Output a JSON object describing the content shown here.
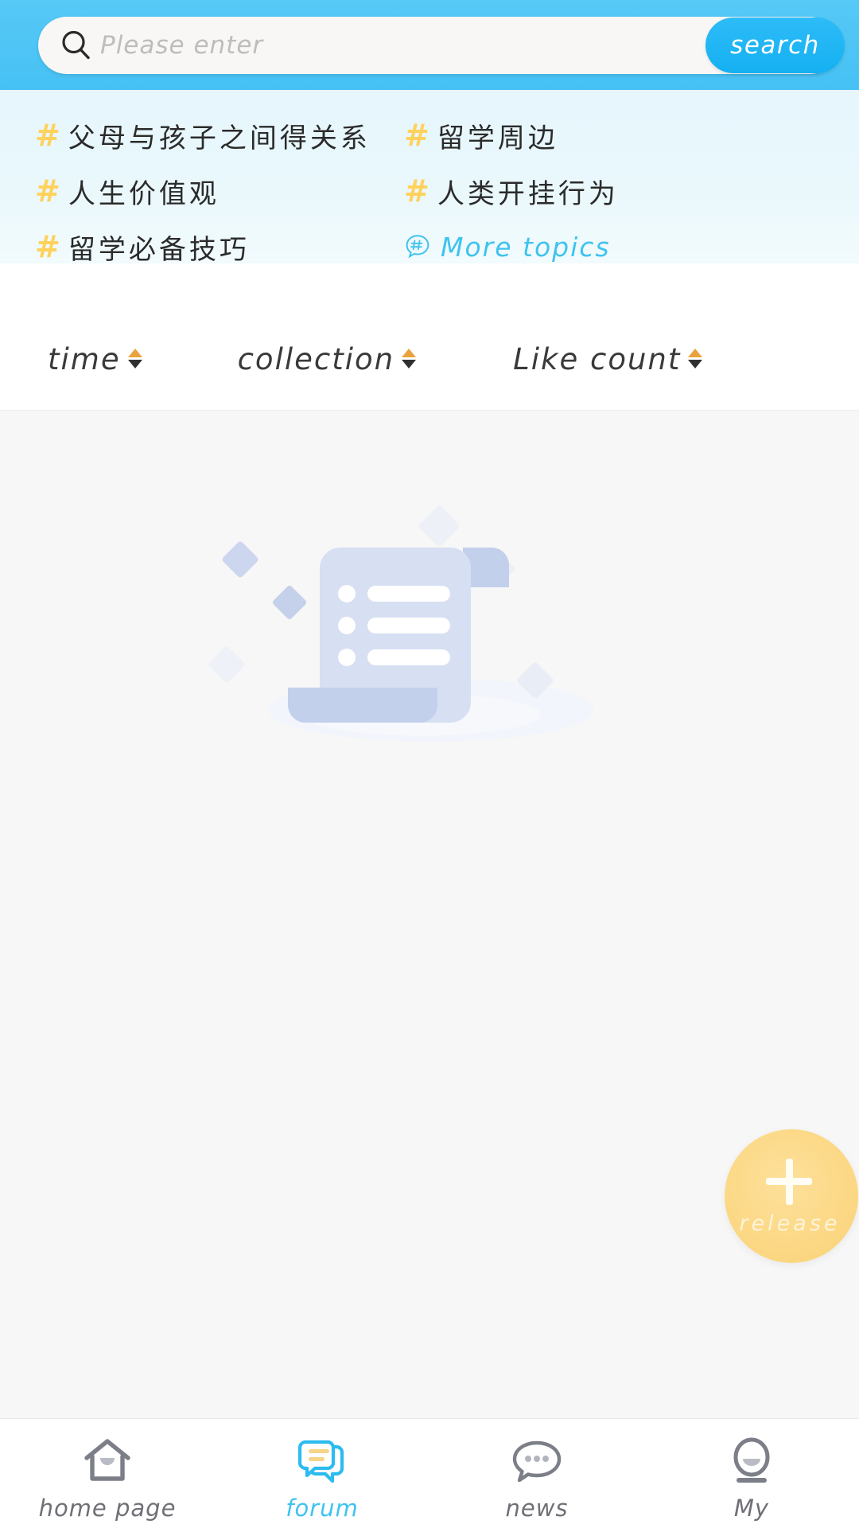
{
  "search": {
    "placeholder": "Please enter",
    "value": "",
    "button_label": "search",
    "icon": "search-icon",
    "bar_color": "#4ec5f5",
    "button_color": "#23b7f4"
  },
  "topics": {
    "hash_color": "#ffd25e",
    "link_color": "#3fc3ef",
    "items": [
      {
        "label": "父母与孩子之间得关系",
        "icon": "hash-icon"
      },
      {
        "label": "留学周边",
        "icon": "hash-icon"
      },
      {
        "label": "人生价值观",
        "icon": "hash-icon"
      },
      {
        "label": "人类开挂行为",
        "icon": "hash-icon"
      },
      {
        "label": "留学必备技巧",
        "icon": "hash-icon"
      }
    ],
    "more": {
      "label": "More topics",
      "icon": "hash-bubble-icon"
    }
  },
  "sort": {
    "up_color": "#e8a33d",
    "down_color": "#2f2f2f",
    "items": [
      {
        "label": "time"
      },
      {
        "label": "collection"
      },
      {
        "label": "Like count"
      }
    ]
  },
  "empty_state": {
    "illustration": "empty-document-list-icon",
    "message": ""
  },
  "fab": {
    "label": "release",
    "icon": "plus-icon",
    "color": "#fcd988"
  },
  "tabbar": {
    "active_index": 1,
    "active_color": "#3fc3ef",
    "inactive_color": "#6f6f76",
    "items": [
      {
        "label": "home page",
        "icon": "home-icon"
      },
      {
        "label": "forum",
        "icon": "chat-bubbles-icon"
      },
      {
        "label": "news",
        "icon": "speech-bubble-dots-icon"
      },
      {
        "label": "My",
        "icon": "person-icon"
      }
    ]
  }
}
